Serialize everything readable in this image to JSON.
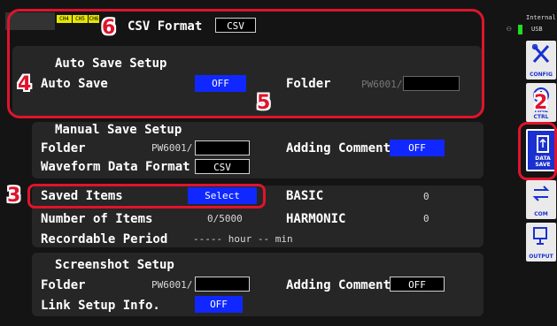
{
  "colors": {
    "accent": "#1028ff",
    "callout": "#e0142c",
    "panel": "#262626"
  },
  "channels": [
    "CH4",
    "CH5",
    "CH6"
  ],
  "csv": {
    "label": "CSV Format",
    "value": "CSV"
  },
  "auto_save": {
    "header": "Auto Save Setup",
    "label": "Auto Save",
    "value": "OFF",
    "folder_label": "Folder",
    "folder_prefix": "PW6001/",
    "folder_value": ""
  },
  "manual_save": {
    "header": "Manual Save Setup",
    "folder_label": "Folder",
    "folder_prefix": "PW6001/",
    "folder_value": "",
    "comment_label": "Adding Comment",
    "comment_value": "OFF",
    "waveform_label": "Waveform Data Format",
    "waveform_value": "CSV"
  },
  "items": {
    "saved_label": "Saved Items",
    "select_label": "Select",
    "basic_label": "BASIC",
    "basic_value": "0",
    "harmonic_label": "HARMONIC",
    "harmonic_value": "0",
    "number_label": "Number of Items",
    "number_value": "0/5000",
    "period_label": "Recordable Period",
    "period_value": "----- hour -- min"
  },
  "screenshot": {
    "header": "Screenshot Setup",
    "folder_label": "Folder",
    "folder_prefix": "PW6001/",
    "folder_value": "",
    "comment_label": "Adding Comment",
    "comment_value": "OFF",
    "link_label": "Link Setup Info.",
    "link_value": "OFF"
  },
  "sidebar": {
    "storage_label": "Internal",
    "storage_value": "USB",
    "items": [
      {
        "label": "CONFIG",
        "icon": "wrench-screwdriver-icon"
      },
      {
        "label": "TIME CTRL",
        "icon": "clock-icon"
      },
      {
        "label": "DATA SAVE",
        "icon": "usb-save-icon"
      },
      {
        "label": "COM",
        "icon": "arrows-icon"
      },
      {
        "label": "OUTPUT",
        "icon": "output-icon"
      }
    ]
  },
  "callouts": [
    "2",
    "3",
    "4",
    "5",
    "6"
  ]
}
